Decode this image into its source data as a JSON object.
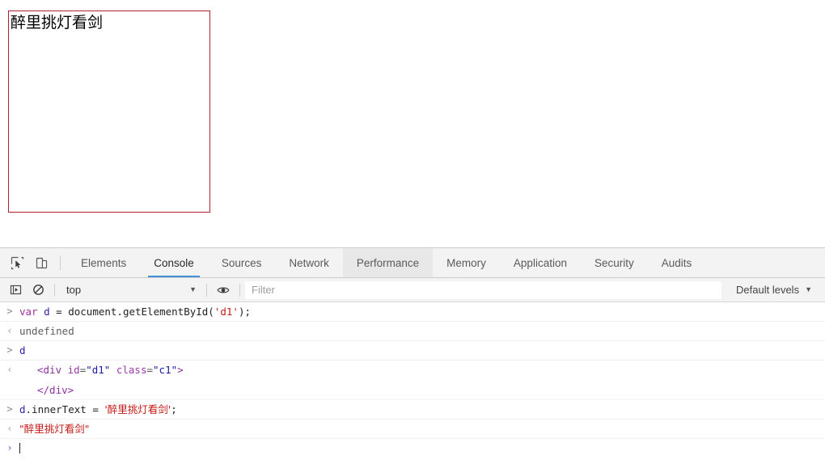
{
  "page": {
    "box": {
      "text": "醉里挑灯看剑",
      "border_color": "#b02030",
      "element_id": "d1",
      "element_class": "c1"
    }
  },
  "devtools": {
    "toolbar_icons": [
      {
        "name": "inspect-element-icon"
      },
      {
        "name": "device-toolbar-icon"
      }
    ],
    "tabs": [
      {
        "label": "Elements",
        "selected": false,
        "hovered": false
      },
      {
        "label": "Console",
        "selected": true,
        "hovered": false
      },
      {
        "label": "Sources",
        "selected": false,
        "hovered": false
      },
      {
        "label": "Network",
        "selected": false,
        "hovered": false
      },
      {
        "label": "Performance",
        "selected": false,
        "hovered": true
      },
      {
        "label": "Memory",
        "selected": false,
        "hovered": false
      },
      {
        "label": "Application",
        "selected": false,
        "hovered": false
      },
      {
        "label": "Security",
        "selected": false,
        "hovered": false
      },
      {
        "label": "Audits",
        "selected": false,
        "hovered": false
      }
    ],
    "accent_color": "#4391d8",
    "console_toolbar": {
      "sidebar_toggle_icon": "console-sidebar-icon",
      "clear_icon": "clear-console-icon",
      "context": "top",
      "context_caret": "▼",
      "eye_icon": "live-expression-eye-icon",
      "filter_placeholder": "Filter",
      "filter_value": "",
      "levels_label": "Default levels",
      "levels_caret": "▼"
    },
    "console_messages": [
      {
        "kind": "input",
        "gutter": ">",
        "tokens": [
          {
            "t": "var",
            "c": "kw"
          },
          {
            "t": " ",
            "c": "plain"
          },
          {
            "t": "d",
            "c": "var"
          },
          {
            "t": " = document.getElementById(",
            "c": "plain"
          },
          {
            "t": "'d1'",
            "c": "str"
          },
          {
            "t": ");",
            "c": "plain"
          }
        ]
      },
      {
        "kind": "result",
        "gutter": "‹",
        "text": "undefined"
      },
      {
        "kind": "input",
        "gutter": ">",
        "tokens": [
          {
            "t": "d",
            "c": "var"
          }
        ]
      },
      {
        "kind": "result-node",
        "gutter": "‹",
        "open_tokens": [
          {
            "t": "<div",
            "c": "tag"
          },
          {
            "t": " id",
            "c": "attr"
          },
          {
            "t": "=",
            "c": "punc"
          },
          {
            "t": "\"d1\"",
            "c": "val"
          },
          {
            "t": " class",
            "c": "attr"
          },
          {
            "t": "=",
            "c": "punc"
          },
          {
            "t": "\"c1\"",
            "c": "val"
          },
          {
            "t": ">",
            "c": "tag"
          }
        ],
        "close_tokens": [
          {
            "t": "</div>",
            "c": "tag"
          }
        ]
      },
      {
        "kind": "input",
        "gutter": ">",
        "tokens": [
          {
            "t": "d",
            "c": "var"
          },
          {
            "t": ".innerText = ",
            "c": "plain"
          },
          {
            "t": "'醉里挑灯看剑'",
            "c": "str"
          },
          {
            "t": ";",
            "c": "plain"
          }
        ]
      },
      {
        "kind": "result-string",
        "gutter": "‹",
        "tokens": [
          {
            "t": "\"醉里挑灯看剑\"",
            "c": "str"
          }
        ]
      }
    ],
    "prompt": {
      "gutter": "›",
      "value": ""
    }
  }
}
